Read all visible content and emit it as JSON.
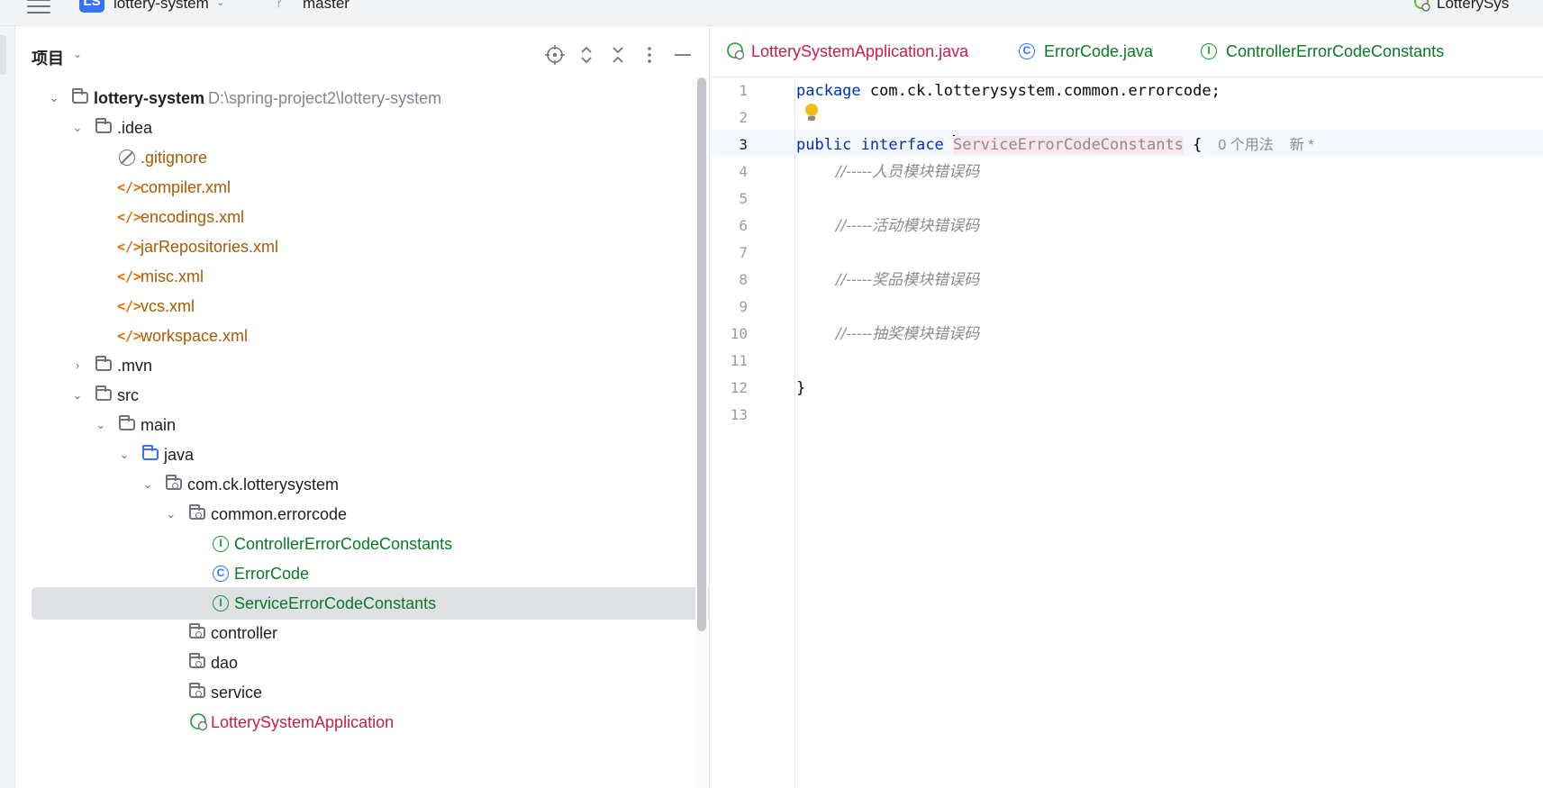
{
  "titlebar": {
    "project_badge": "LS",
    "project_name": "lottery-system",
    "branch_name": "master",
    "run_config": "LotterySys"
  },
  "project_panel": {
    "title": "项目",
    "tools": [
      "locate-icon",
      "expand-all-icon",
      "collapse-all-icon",
      "more-icon",
      "hide-icon"
    ]
  },
  "tree": {
    "root": {
      "label": "lottery-system",
      "path": "D:\\spring-project2\\lottery-system"
    },
    "idea": ".idea",
    "gitignore": ".gitignore",
    "compiler": "compiler.xml",
    "encodings": "encodings.xml",
    "jarrepos": "jarRepositories.xml",
    "misc": "misc.xml",
    "vcs": "vcs.xml",
    "workspace": "workspace.xml",
    "mvn": ".mvn",
    "src": "src",
    "main": "main",
    "java": "java",
    "pkg": "com.ck.lotterysystem",
    "errorcode_pkg": "common.errorcode",
    "ctrl_const": "ControllerErrorCodeConstants",
    "errorcode": "ErrorCode",
    "svc_const": "ServiceErrorCodeConstants",
    "controller": "controller",
    "dao": "dao",
    "service": "service",
    "app": "LotterySystemApplication"
  },
  "editor": {
    "tabs": [
      "LotterySystemApplication.java",
      "ErrorCode.java",
      "ControllerErrorCodeConstants"
    ],
    "line_numbers": [
      "1",
      "2",
      "3",
      "4",
      "5",
      "6",
      "7",
      "8",
      "9",
      "10",
      "11",
      "12",
      "13"
    ],
    "current_line": 3,
    "code": {
      "l1_kw": "package",
      "l1_rest": " com.ck.lotterysystem.common.errorcode;",
      "l3_kw1": "public",
      "l3_kw2": "interface",
      "l3_ident": "ServiceErrorCodeConstants",
      "l3_brace": " {",
      "l3_hint1": "0 个用法",
      "l3_hint2": "新 *",
      "l4": "//-----人员模块错误码",
      "l6": "//-----活动模块错误码",
      "l8": "//-----奖品模块错误码",
      "l10": "//-----抽奖模块错误码",
      "l12": "}"
    }
  }
}
